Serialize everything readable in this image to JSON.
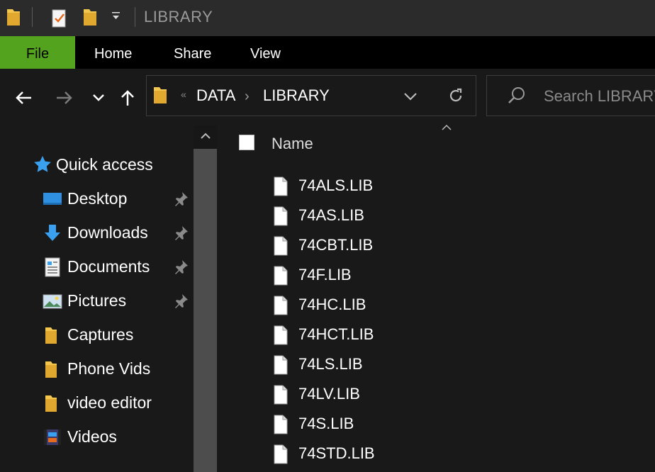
{
  "window": {
    "title": "LIBRARY"
  },
  "ribbon": {
    "tabs": [
      "File",
      "Home",
      "Share",
      "View"
    ]
  },
  "address": {
    "crumbs": [
      "DATA",
      "LIBRARY"
    ],
    "overflow": "«"
  },
  "search": {
    "placeholder": "Search LIBRARY"
  },
  "sidebar": {
    "quick_access": "Quick access",
    "items": [
      {
        "label": "Desktop",
        "icon": "desktop-icon",
        "pinned": true
      },
      {
        "label": "Downloads",
        "icon": "downloads-icon",
        "pinned": true
      },
      {
        "label": "Documents",
        "icon": "documents-icon",
        "pinned": true
      },
      {
        "label": "Pictures",
        "icon": "pictures-icon",
        "pinned": true
      },
      {
        "label": "Captures",
        "icon": "folder-icon",
        "pinned": false
      },
      {
        "label": "Phone Vids",
        "icon": "folder-icon",
        "pinned": false
      },
      {
        "label": "video editor",
        "icon": "folder-icon",
        "pinned": false
      },
      {
        "label": "Videos",
        "icon": "videos-icon",
        "pinned": false
      }
    ]
  },
  "content": {
    "column_header": "Name",
    "files": [
      "74ALS.LIB",
      "74AS.LIB",
      "74CBT.LIB",
      "74F.LIB",
      "74HC.LIB",
      "74HCT.LIB",
      "74LS.LIB",
      "74LV.LIB",
      "74S.LIB",
      "74STD.LIB"
    ]
  },
  "colors": {
    "file_tab": "#54a31e",
    "background": "#191919",
    "titlebar": "#2b2b2b",
    "folder": "#f3c74f"
  }
}
